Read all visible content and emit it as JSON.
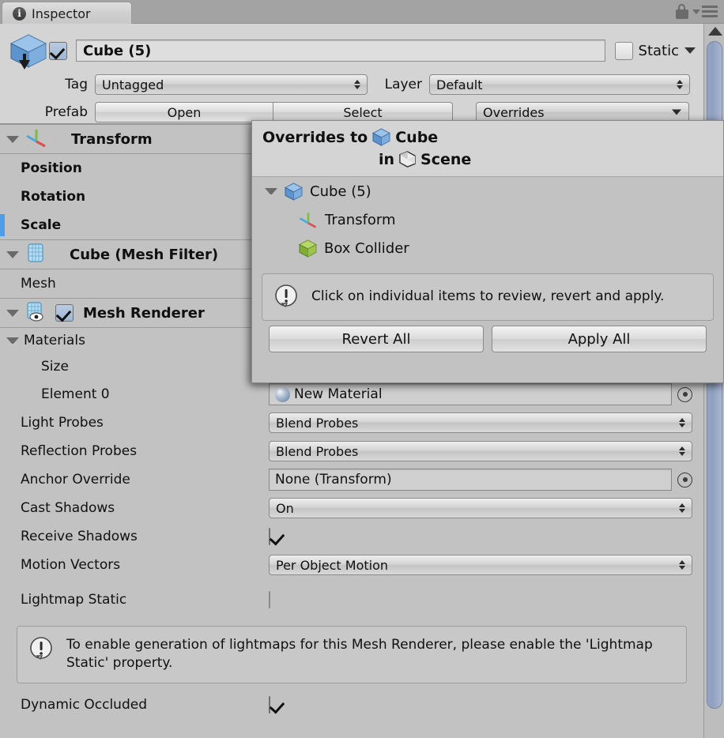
{
  "window": {
    "tab_label": "Inspector",
    "tab_icon": "info-icon",
    "lock_icon": "lock-icon",
    "menu_icon": "hamburger-menu-icon"
  },
  "object_header": {
    "enabled_checkbox": true,
    "name": "Cube (5)",
    "static_label": "Static",
    "static_checked": false,
    "tag_label": "Tag",
    "tag_value": "Untagged",
    "layer_label": "Layer",
    "layer_value": "Default",
    "prefab_label": "Prefab",
    "open_button": "Open",
    "select_button": "Select",
    "overrides_button": "Overrides"
  },
  "overrides_popup": {
    "title_prefix": "Overrides to",
    "title_target": "Cube",
    "subtitle_prefix": "in",
    "subtitle_target": "Scene",
    "tree": [
      {
        "label": "Cube (5)",
        "icon": "cube-icon",
        "level": 1,
        "expanded": true
      },
      {
        "label": "Transform",
        "icon": "transform-icon",
        "level": 2,
        "expanded": false
      },
      {
        "label": "Box Collider",
        "icon": "box-collider-icon",
        "level": 2,
        "expanded": false
      }
    ],
    "info_text": "Click on individual items to review, revert and apply.",
    "revert_all": "Revert All",
    "apply_all": "Apply All"
  },
  "components": [
    {
      "name": "Transform",
      "icon": "transform-icon",
      "expanded": true,
      "has_enable_checkbox": false,
      "rows": [
        {
          "label": "Position",
          "bold": true,
          "override": false
        },
        {
          "label": "Rotation",
          "bold": true,
          "override": false
        },
        {
          "label": "Scale",
          "bold": true,
          "override": true
        }
      ]
    },
    {
      "name": "Cube (Mesh Filter)",
      "icon": "mesh-filter-icon",
      "expanded": true,
      "has_enable_checkbox": false,
      "rows": [
        {
          "label": "Mesh",
          "bold": false,
          "override": false
        }
      ]
    },
    {
      "name": "Mesh Renderer",
      "icon": "mesh-renderer-icon",
      "expanded": true,
      "has_enable_checkbox": true,
      "enabled": true,
      "rows": []
    }
  ],
  "mesh_renderer": {
    "materials_label": "Materials",
    "size_label": "Size",
    "element0_label": "Element 0",
    "element0_value": "New Material",
    "properties": [
      {
        "label": "Light Probes",
        "type": "dropdown",
        "value": "Blend Probes"
      },
      {
        "label": "Reflection Probes",
        "type": "dropdown",
        "value": "Blend Probes"
      },
      {
        "label": "Anchor Override",
        "type": "objectfield",
        "value": "None (Transform)"
      },
      {
        "label": "Cast Shadows",
        "type": "dropdown",
        "value": "On"
      },
      {
        "label": "Receive Shadows",
        "type": "checkbox",
        "checked": true
      },
      {
        "label": "Motion Vectors",
        "type": "dropdown",
        "value": "Per Object Motion"
      }
    ],
    "lightmap_static_label": "Lightmap Static",
    "lightmap_static_checked": false,
    "lightmap_help": "To enable generation of lightmaps for this Mesh Renderer, please enable the 'Lightmap Static' property.",
    "dynamic_occluded_label": "Dynamic Occluded",
    "dynamic_occluded_checked": true
  },
  "colors": {
    "panel_bg": "#c2c2c2",
    "header_bg": "#d4d4d4",
    "tabstrip_bg": "#a3a3a3",
    "override_marker": "#4a9eeb",
    "scrollbar_thumb": "#93a4c4"
  }
}
